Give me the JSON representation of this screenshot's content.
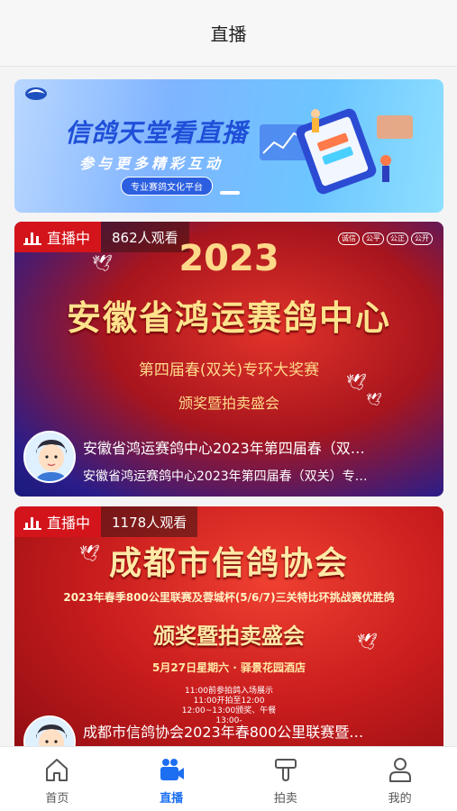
{
  "header": {
    "title": "直播"
  },
  "banner": {
    "title": "信鸽天堂看直播",
    "subtitle": "参与更多精彩互动",
    "tag": "专业赛鸽文化平台"
  },
  "cards": [
    {
      "live_label": "直播中",
      "viewers": "862人观看",
      "tags": [
        "诚信",
        "公平",
        "公正",
        "公开"
      ],
      "poster_year": "2023",
      "poster_main": "安徽省鸿运赛鸽中心",
      "poster_sub1": "第四届春(双关)专环大奖赛",
      "poster_sub2": "颁奖暨拍卖盛会",
      "title": "安徽省鸿运赛鸽中心2023年第四届春（双…",
      "desc": "安徽省鸿运赛鸽中心2023年第四届春（双关）专…"
    },
    {
      "live_label": "直播中",
      "viewers": "1178人观看",
      "poster_main": "成都市信鸽协会",
      "poster_sub1": "2023年春季800公里联赛及蓉城杯(5/6/7)三关特比环挑战赛优胜鸽",
      "poster_main2": "颁奖暨拍卖盛会",
      "poster_sub2": "5月27日星期六 · 驿景花园酒店",
      "schedule": [
        "11:00前参拍鸽入场展示",
        "11:00开拍至12:00",
        "12:00~13:00颁奖、午餐",
        "13:00-"
      ],
      "title": "成都市信鸽协会2023年春800公里联赛暨…"
    }
  ],
  "tabs": [
    {
      "label": "首页",
      "icon": "home-icon",
      "active": false
    },
    {
      "label": "直播",
      "icon": "video-camera-icon",
      "active": true
    },
    {
      "label": "拍卖",
      "icon": "gavel-icon",
      "active": false
    },
    {
      "label": "我的",
      "icon": "user-icon",
      "active": false
    }
  ],
  "colors": {
    "accent": "#1d6ff2",
    "live_red": "#d4141b"
  }
}
